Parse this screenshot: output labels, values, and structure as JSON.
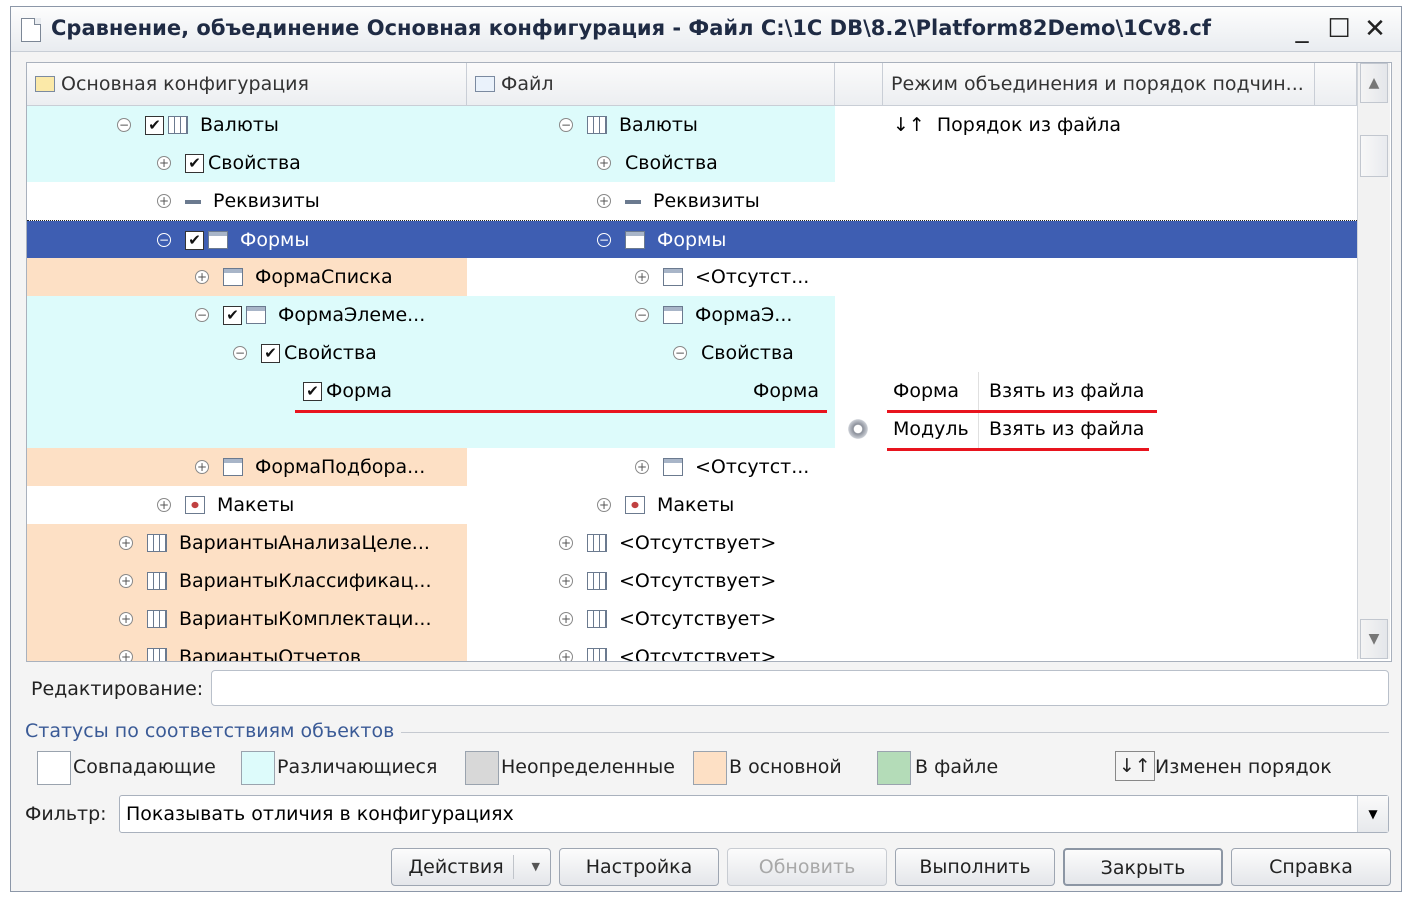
{
  "window": {
    "title": "Сравнение, объединение Основная конфигурация - Файл C:\\1C DB\\8.2\\Platform82Demo\\1Cv8.cf",
    "minimize": "_",
    "maximize": "☐",
    "close": "✕"
  },
  "grid": {
    "headers": {
      "main": "Основная конфигурация",
      "file": "Файл",
      "mode": "Режим объединения и порядок подчин..."
    },
    "rows": [
      {
        "main": "Валюты",
        "file": "Валюты",
        "mode": "Порядок из файла",
        "mode_icon": "↓↑"
      },
      {
        "main": "Свойства",
        "file": "Свойства"
      },
      {
        "main": "Реквизиты",
        "file": "Реквизиты"
      },
      {
        "main": "Формы",
        "file": "Формы"
      },
      {
        "main": "ФормаСписка",
        "file": "<Отсутст..."
      },
      {
        "main": "ФормаЭлеме...",
        "file": "ФормаЭ..."
      },
      {
        "main": "Свойства",
        "file": "Свойства"
      },
      {
        "main": "Форма",
        "file": "Форма",
        "mode_name": "Форма",
        "mode_value": "Взять из файла"
      },
      {
        "mode_name": "Модуль",
        "mode_value": "Взять из файла"
      },
      {
        "main": "ФормаПодбора...",
        "file": "<Отсутст..."
      },
      {
        "main": "Макеты",
        "file": "Макеты"
      },
      {
        "main": "ВариантыАнализаЦеле...",
        "file": "<Отсутствует>"
      },
      {
        "main": "ВариантыКлассификац...",
        "file": "<Отсутствует>"
      },
      {
        "main": "ВариантыКомплектаци...",
        "file": "<Отсутствует>"
      },
      {
        "main": "ВариантыОтчетов",
        "file": "<Отсутствует>"
      }
    ]
  },
  "editing": {
    "label": "Редактирование:",
    "value": ""
  },
  "statuses": {
    "title": "Статусы по соответствиям объектов",
    "items": [
      {
        "label": "Совпадающие",
        "color": "#ffffff"
      },
      {
        "label": "Различающиеся",
        "color": "#ddfbfb"
      },
      {
        "label": "Неопределенные",
        "color": "#d8d8d8"
      },
      {
        "label": "В основной",
        "color": "#fde0c5"
      },
      {
        "label": "В файле",
        "color": "#b4dcb8"
      }
    ],
    "order_icon": "↓↑",
    "order_label": "Изменен порядок"
  },
  "filter": {
    "label": "Фильтр:",
    "value": "Показывать отличия в конфигурациях"
  },
  "buttons": {
    "actions": "Действия",
    "settings": "Настройка",
    "refresh": "Обновить",
    "execute": "Выполнить",
    "close": "Закрыть",
    "help": "Справка"
  },
  "colors": {
    "differing": "#ddfbfb",
    "in_main": "#fde0c5",
    "selection": "#3e5eb2",
    "annotation": "#e8141e"
  }
}
